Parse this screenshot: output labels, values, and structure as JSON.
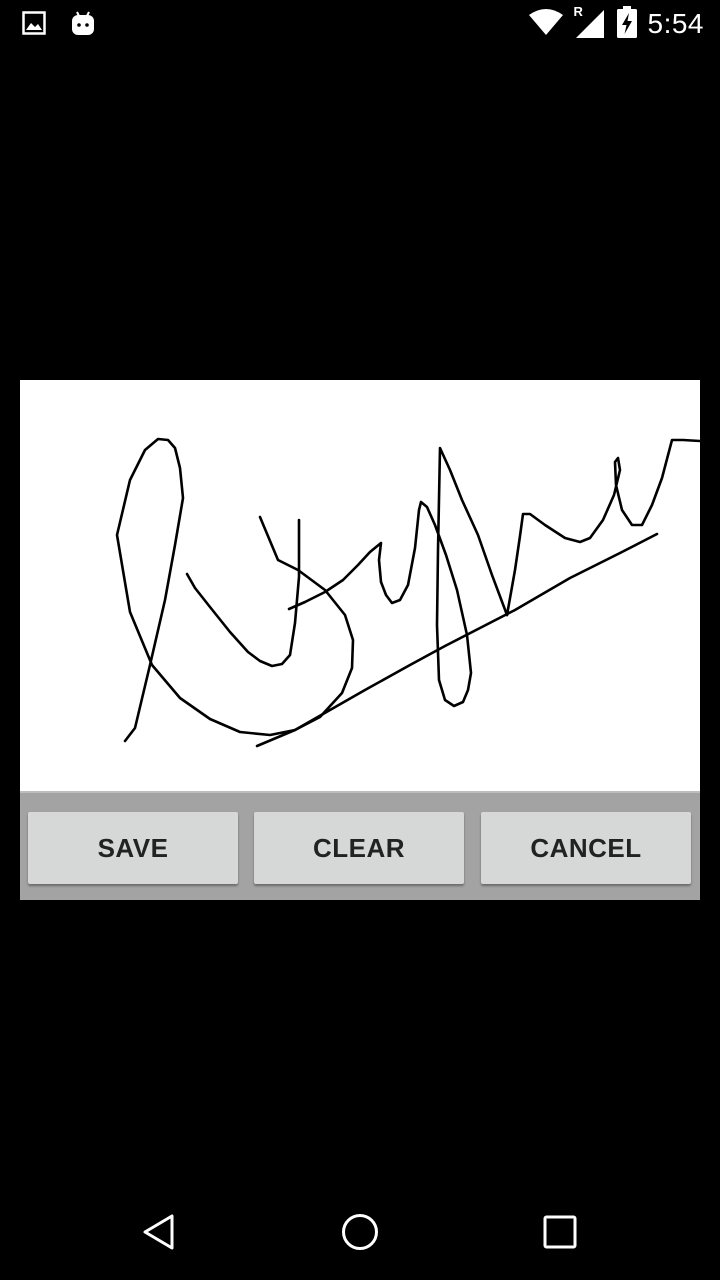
{
  "status_bar": {
    "time": "5:54",
    "left_icons": [
      "image-icon",
      "android-icon"
    ],
    "right_icons": [
      "wifi-icon",
      "cell-signal-icon",
      "battery-charging-icon"
    ],
    "signal_roaming_label": "R"
  },
  "dialog": {
    "signature_pad": {
      "background": "#ffffff",
      "stroke_color": "#000000"
    },
    "buttons": {
      "save": "SAVE",
      "clear": "CLEAR",
      "cancel": "CANCEL"
    }
  },
  "nav_bar": {
    "icons": [
      "back-icon",
      "home-icon",
      "recent-apps-icon"
    ]
  }
}
